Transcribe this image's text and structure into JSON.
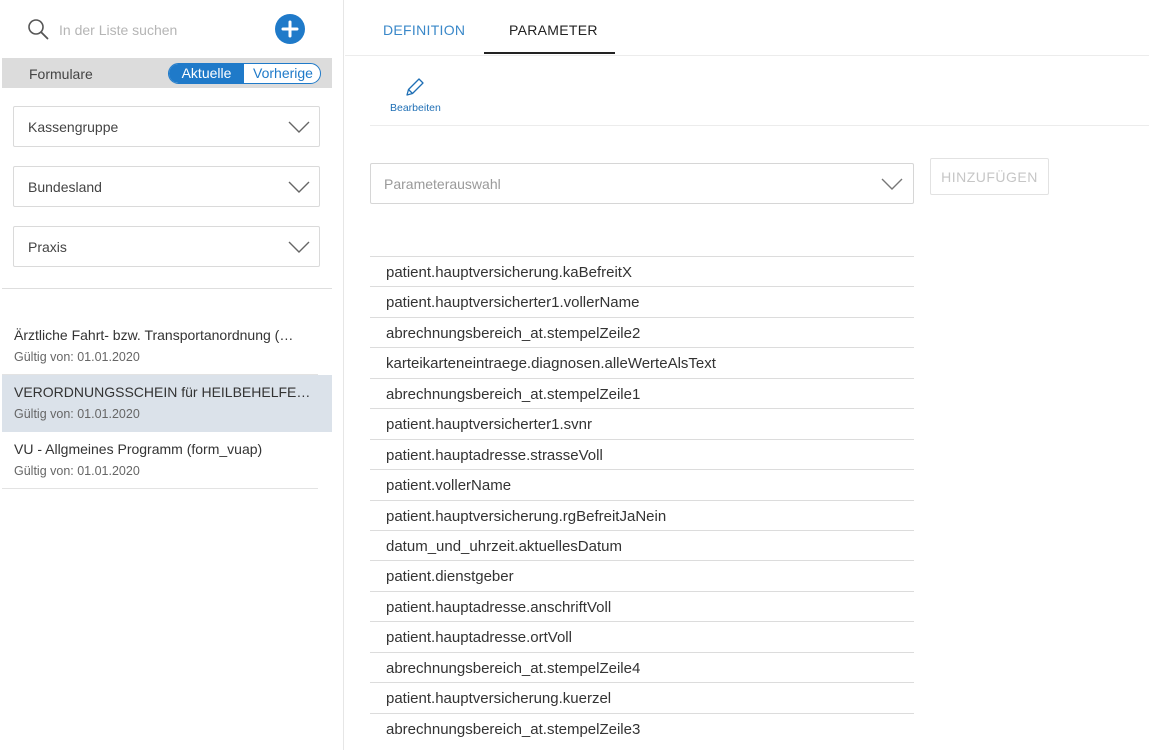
{
  "search": {
    "placeholder": "In der Liste suchen"
  },
  "filter_bar": {
    "label": "Formulare",
    "toggle_active": "Aktuelle",
    "toggle_inactive": "Vorherige"
  },
  "dropdowns": [
    {
      "label": "Kassengruppe"
    },
    {
      "label": "Bundesland"
    },
    {
      "label": "Praxis"
    }
  ],
  "forms": [
    {
      "title": "Ärztliche Fahrt- bzw. Transportanordnung (…",
      "valid": "Gültig von: 01.01.2020",
      "selected": false
    },
    {
      "title": "VERORDNUNGSSCHEIN für HEILBEHELFE u…",
      "valid": "Gültig von: 01.01.2020",
      "selected": true
    },
    {
      "title": "VU - Allgmeines Programm (form_vuap)",
      "valid": "Gültig von: 01.01.2020",
      "selected": false
    }
  ],
  "tabs": {
    "definition": "DEFINITION",
    "parameter": "PARAMETER",
    "active": "parameter"
  },
  "toolbar": {
    "edit_label": "Bearbeiten"
  },
  "parameter_select": {
    "placeholder": "Parameterauswahl"
  },
  "add_button": {
    "label": "HINZUFÜGEN"
  },
  "parameters": [
    "patient.hauptversicherung.kaBefreitX",
    "patient.hauptversicherter1.vollerName",
    "abrechnungsbereich_at.stempelZeile2",
    "karteikarteneintraege.diagnosen.alleWerteAlsText",
    "abrechnungsbereich_at.stempelZeile1",
    "patient.hauptversicherter1.svnr",
    "patient.hauptadresse.strasseVoll",
    "patient.vollerName",
    "patient.hauptversicherung.rgBefreitJaNein",
    "datum_und_uhrzeit.aktuellesDatum",
    "patient.dienstgeber",
    "patient.hauptadresse.anschriftVoll",
    "patient.hauptadresse.ortVoll",
    "abrechnungsbereich_at.stempelZeile4",
    "patient.hauptversicherung.kuerzel",
    "abrechnungsbereich_at.stempelZeile3"
  ],
  "colors": {
    "accent": "#1f7ac9",
    "selected_row": "#dbe2ea",
    "tab_inactive": "#3a88c9"
  }
}
